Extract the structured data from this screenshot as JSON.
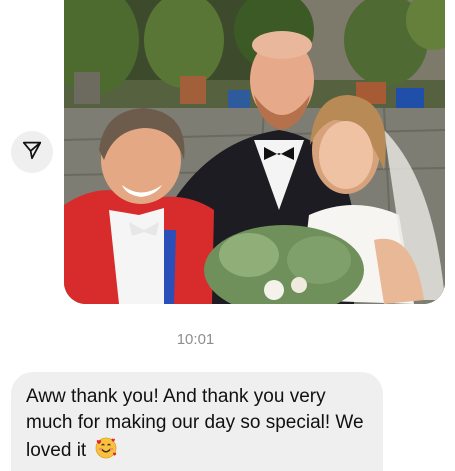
{
  "conversation": {
    "shared_photo": {
      "alt": "wedding selfie"
    },
    "share_button": {
      "icon": "paper-plane-icon"
    },
    "timestamp": "10:01",
    "reply": {
      "text": "Aww thank you! And thank you very much for making our day so special! We loved it",
      "emoji": "smiling-face-with-hearts-icon"
    }
  },
  "colors": {
    "bubble_bg": "#efefef",
    "timestamp_text": "#8e8e8e",
    "message_text": "#111111"
  }
}
